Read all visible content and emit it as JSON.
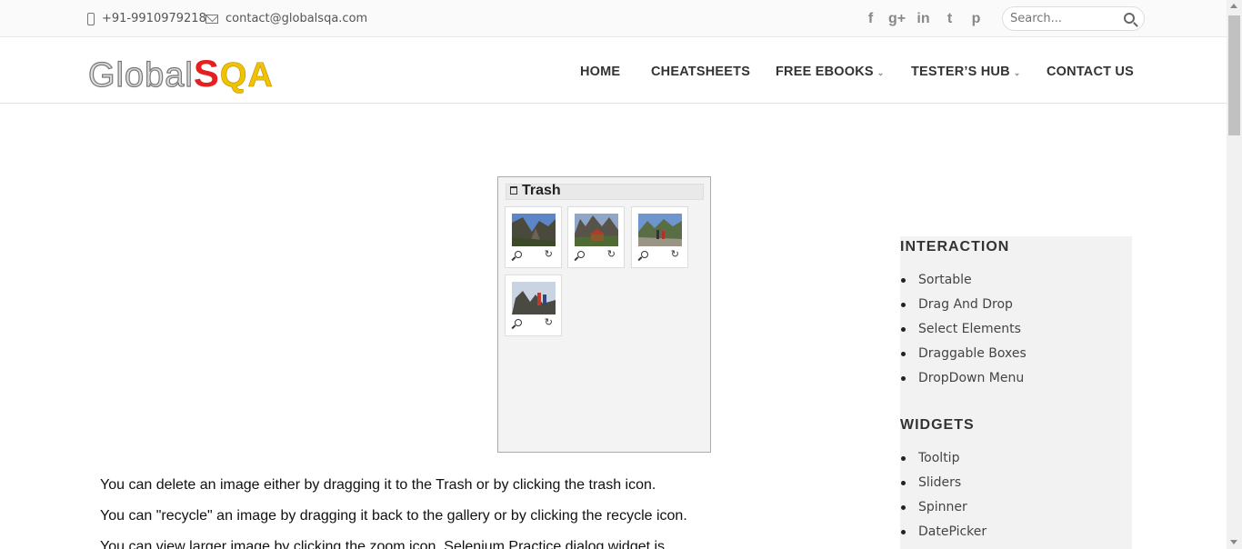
{
  "topbar": {
    "phone": "+91-9910979218",
    "email": "contact@globalsqa.com",
    "social": [
      {
        "name": "facebook-icon",
        "glyph": "f"
      },
      {
        "name": "google-plus-icon",
        "glyph": "g+"
      },
      {
        "name": "linkedin-icon",
        "glyph": "in"
      },
      {
        "name": "twitter-icon",
        "glyph": "t"
      },
      {
        "name": "pinterest-icon",
        "glyph": "p"
      }
    ],
    "search_placeholder": "Search..."
  },
  "logo": {
    "part1": "Global",
    "part2": "S",
    "part3": "QA"
  },
  "nav": {
    "home": "HOME",
    "cheatsheets": "CHEATSHEETS",
    "free_ebooks": "FREE EBOOKS",
    "testers_hub": "TESTER’S HUB",
    "contact_us": "CONTACT US"
  },
  "trash": {
    "title": "Trash"
  },
  "paragraphs": {
    "p1": "You can delete an image either by dragging it to the Trash or by clicking the trash icon.",
    "p2": "You can \"recycle\" an image by dragging it back to the gallery or by clicking the recycle icon.",
    "p3": "You can view larger image by clicking the zoom icon. Selenium Practice dialog widget is"
  },
  "sidebar": {
    "interaction_heading": "INTERACTION",
    "interaction_items": [
      "Sortable",
      "Drag And Drop",
      "Select Elements",
      "Draggable Boxes",
      "DropDown Menu"
    ],
    "widgets_heading": "WIDGETS",
    "widgets_items": [
      "Tooltip",
      "Sliders",
      "Spinner",
      "DatePicker"
    ]
  },
  "colors": {
    "logo_red": "#e62020",
    "logo_yellow": "#f2c200",
    "sidebar_bg": "#f2f2f2"
  }
}
